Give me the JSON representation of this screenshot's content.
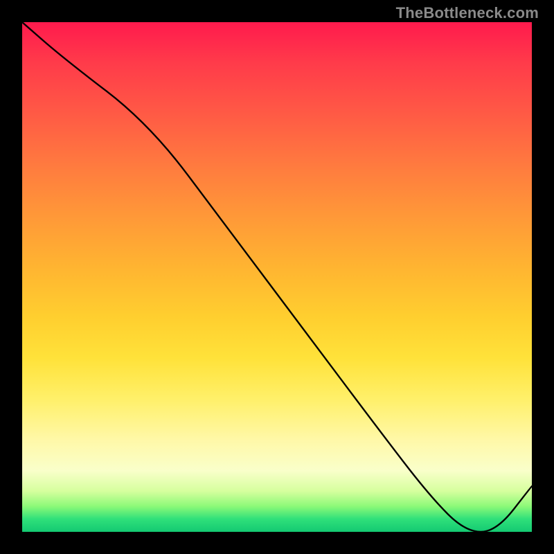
{
  "watermark": "TheBottleneck.com",
  "chart_data": {
    "type": "line",
    "title": "",
    "xlabel": "",
    "ylabel": "",
    "xlim": [
      0,
      100
    ],
    "ylim": [
      0,
      100
    ],
    "series": [
      {
        "name": "curve",
        "x": [
          0,
          8,
          25,
          40,
          55,
          70,
          80,
          87,
          93,
          100
        ],
        "y": [
          100,
          93,
          80,
          60,
          40,
          20,
          7,
          0,
          0,
          9
        ]
      }
    ],
    "gradient": "vertical-rainbow-red-to-green",
    "annotations": [
      {
        "kind": "label",
        "text": "",
        "x": 90,
        "y": 1
      }
    ]
  },
  "labels": {
    "valley": ""
  }
}
